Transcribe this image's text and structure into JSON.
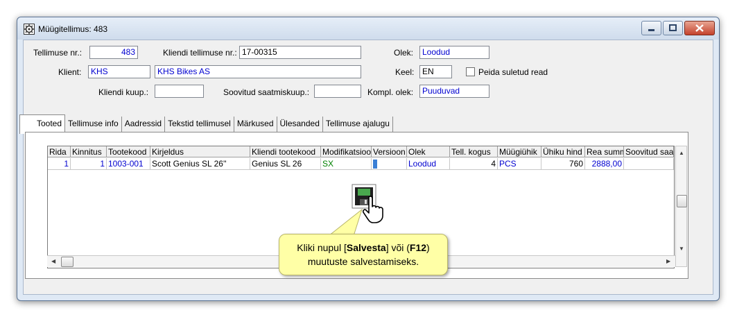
{
  "window": {
    "title": "Müügitellimus: 483"
  },
  "form": {
    "order_no_label": "Tellimuse nr.:",
    "order_no": "483",
    "client_order_no_label": "Kliendi tellimuse nr.:",
    "client_order_no": "17-00315",
    "status_label": "Olek:",
    "status": "Loodud",
    "client_label": "Klient:",
    "client_code": "KHS",
    "client_name": "KHS Bikes AS",
    "language_label": "Keel:",
    "language": "EN",
    "hide_closed_label": "Peida suletud read",
    "client_purchase_date_label": "Kliendi kuup.:",
    "client_purchase_date": "",
    "desired_delivery_date_label": "Soovitud saatmiskuup.:",
    "desired_delivery_date": "",
    "completion_status_label": "Kompl. olek:",
    "completion_status": "Puuduvad"
  },
  "tabs": [
    "Tooted",
    "Tellimuse info",
    "Aadressid",
    "Tekstid tellimusel",
    "Märkused",
    "Ülesanded",
    "Tellimuse ajalugu"
  ],
  "grid": {
    "headers": [
      "Rida",
      "Kinnitus",
      "Tootekood",
      "Kirjeldus",
      "Kliendi tootekood",
      "Modifikatsioo",
      "Versioon",
      "Olek",
      "Tell. kogus",
      "Müügiühik",
      "Ühiku hind",
      "Rea summ",
      "Soovitud saa"
    ],
    "rows": [
      [
        "1",
        "1",
        "1003-001",
        "Scott Genius SL 26''",
        "Genius SL 26",
        "SX",
        "",
        "Loodud",
        "4",
        "PCS",
        "760",
        "2888,00",
        ""
      ]
    ]
  },
  "callout": {
    "pre": "Kliki nupul [",
    "button": "Salvesta",
    "mid": "] või (",
    "key": "F12",
    "post": ")",
    "line2": "muutuste salvestamiseks."
  },
  "colors": {
    "value_blue": "#0000d0",
    "value_green": "#008000",
    "callout_bg": "#ffffa6"
  }
}
